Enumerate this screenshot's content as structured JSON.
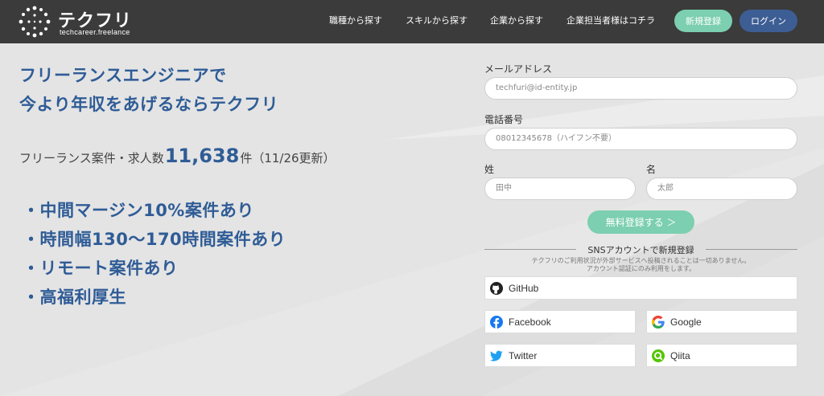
{
  "header": {
    "logo_text": "テクフリ",
    "logo_sub": "techcareer.freelance",
    "nav": [
      "職種から探す",
      "スキルから探す",
      "企業から探す",
      "企業担当者様はコチラ"
    ],
    "register_label": "新規登録",
    "login_label": "ログイン"
  },
  "hero": {
    "headline_line1": "フリーランスエンジニアで",
    "headline_line2": "今より年収をあげるならテクフリ",
    "stats_prefix": "フリーランス案件・求人数",
    "stats_count": "11,638",
    "stats_suffix": "件（11/26更新）",
    "features": [
      "・中間マージン10%案件あり",
      "・時間幅130〜170時間案件あり",
      "・リモート案件あり",
      "・高福利厚生"
    ]
  },
  "form": {
    "email_label": "メールアドレス",
    "email_placeholder": "techfuri@id-entity.jp",
    "phone_label": "電話番号",
    "phone_placeholder": "08012345678（ハイフン不要）",
    "last_name_label": "姓",
    "last_name_placeholder": "田中",
    "first_name_label": "名",
    "first_name_placeholder": "太郎",
    "submit_label": "無料登録する ＞",
    "sns_title": "SNSアカウントで新規登録",
    "sns_note_line1": "テクフリのご利用状況が外部サービスへ投稿されることは一切ありません。",
    "sns_note_line2": "アカウント認証にのみ利用をします。",
    "sns": {
      "github": "GitHub",
      "facebook": "Facebook",
      "google": "Google",
      "twitter": "Twitter",
      "qiita": "Qiita"
    }
  },
  "colors": {
    "header_bg": "#3b3b3b",
    "accent_green": "#7ccfb0",
    "accent_blue": "#3d5e94",
    "headline_blue": "#2f5c96"
  }
}
